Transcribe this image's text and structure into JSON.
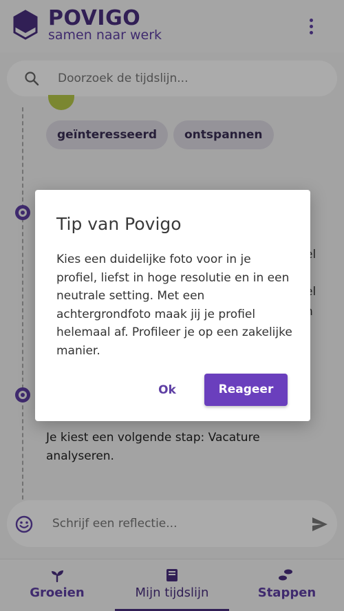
{
  "header": {
    "title": "POVIGO",
    "subtitle": "samen naar werk"
  },
  "search": {
    "placeholder": "Doorzoek de tijdslijn..."
  },
  "timeline": {
    "chips": [
      "geïnteresseerd",
      "ontspannen"
    ],
    "fragments": [
      "el",
      "el",
      "n"
    ],
    "step_text": "Je kiest een volgende stap: Vacature analyseren."
  },
  "composer": {
    "placeholder": "Schrijf een reflectie..."
  },
  "bottom_nav": {
    "items": [
      {
        "label": "Groeien",
        "icon": "sprout-icon"
      },
      {
        "label": "Mijn tijdslijn",
        "icon": "book-icon"
      },
      {
        "label": "Stappen",
        "icon": "footsteps-icon"
      }
    ],
    "active_index": 1
  },
  "dialog": {
    "title": "Tip van Povigo",
    "body": "Kies een duidelijke foto voor in je profiel, liefst in hoge resolutie en in een neutrale setting. Met een achtergrondfoto maak jij je profiel helemaal af. Profileer je op een zakelijke manier.",
    "ok_label": "Ok",
    "respond_label": "Reageer"
  },
  "colors": {
    "brand_purple": "#5e3fa4",
    "button_purple": "#6a3fbd",
    "dark_purple": "#4a2f7f",
    "chip_bg": "#dedbe5"
  }
}
